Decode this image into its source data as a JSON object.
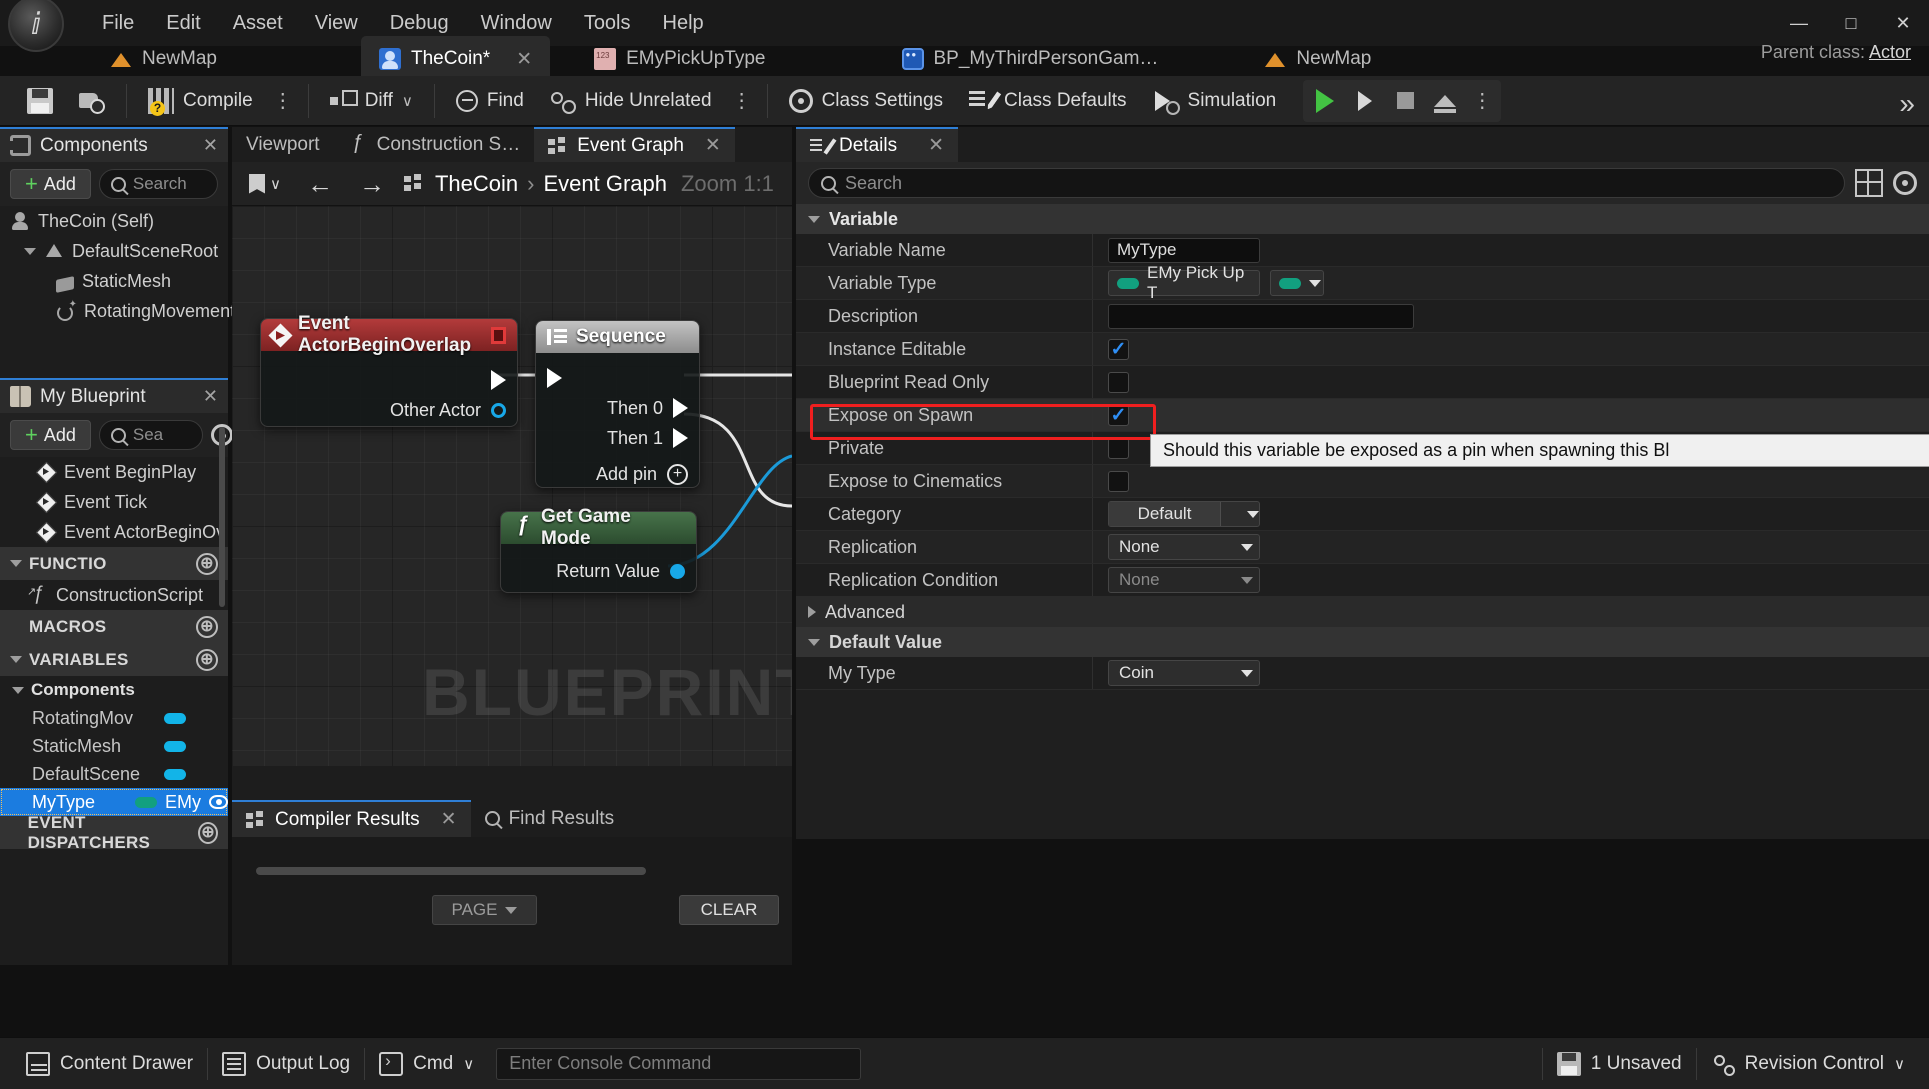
{
  "window": {
    "menu": [
      "File",
      "Edit",
      "Asset",
      "View",
      "Debug",
      "Window",
      "Tools",
      "Help"
    ],
    "minimize": "—",
    "maximize": "□",
    "close": "✕",
    "parent_class_label": "Parent class:",
    "parent_class_value": "Actor"
  },
  "tabs": [
    {
      "label": "NewMap",
      "icon": "map-icon",
      "active": false,
      "closable": false
    },
    {
      "label": "TheCoin*",
      "icon": "blueprint-actor-icon",
      "active": true,
      "closable": true,
      "close": "✕"
    },
    {
      "label": "EMyPickUpType",
      "icon": "enum-icon",
      "active": false,
      "closable": false
    },
    {
      "label": "BP_MyThirdPersonGam…",
      "icon": "gamemode-icon",
      "active": false,
      "closable": false
    },
    {
      "label": "NewMap",
      "icon": "map-icon",
      "active": false,
      "closable": false
    }
  ],
  "toolbar": {
    "save": "",
    "browse": "",
    "compile": "Compile",
    "compile_dots": "⋮",
    "diff": "Diff",
    "diff_chevron": "∨",
    "find": "Find",
    "hide_unrelated": "Hide Unrelated",
    "hide_dots": "⋮",
    "class_settings": "Class Settings",
    "class_defaults": "Class Defaults",
    "simulation": "Simulation",
    "play_dots": "⋮",
    "overflow": "»"
  },
  "components_panel": {
    "title": "Components",
    "close": "✕",
    "add_label": "Add",
    "search_placeholder": "Search",
    "tree": [
      {
        "label": "TheCoin (Self)",
        "icon": "actor-icon",
        "depth": 0,
        "expander": false
      },
      {
        "label": "DefaultSceneRoot",
        "icon": "scene-root-icon",
        "depth": 1,
        "expander": true
      },
      {
        "label": "StaticMesh",
        "icon": "static-mesh-icon",
        "depth": 2,
        "expander": false
      },
      {
        "label": "RotatingMovement",
        "icon": "rotating-movement-icon",
        "depth": 2,
        "expander": false
      }
    ]
  },
  "my_blueprint_panel": {
    "title": "My Blueprint",
    "close": "✕",
    "add_label": "Add",
    "search_placeholder": "Sea",
    "graphs": [
      {
        "label": "Event BeginPlay",
        "icon": "event-icon"
      },
      {
        "label": "Event Tick",
        "icon": "event-icon"
      },
      {
        "label": "Event ActorBeginOv",
        "icon": "event-icon"
      }
    ],
    "sections": {
      "functions": "FUNCTIO",
      "functions_item": "ConstructionScript",
      "macros": "MACROS",
      "variables": "VARIABLES",
      "components_group": "Components",
      "event_dispatchers": "EVENT DISPATCHERS"
    },
    "variables": [
      {
        "name": "RotatingMov",
        "type_color": "#12b4e8",
        "selected": false
      },
      {
        "name": "StaticMesh",
        "type_color": "#12b4e8",
        "selected": false
      },
      {
        "name": "DefaultScene",
        "type_color": "#12b4e8",
        "selected": false
      },
      {
        "name": "MyType",
        "type_short": "EMy",
        "type_color": "#12a07f",
        "selected": true
      }
    ],
    "add_icon": "⊕"
  },
  "graph": {
    "doc_tabs": [
      {
        "label": "Viewport",
        "active": false
      },
      {
        "label": "Construction S…",
        "active": false,
        "icon": "function-icon"
      },
      {
        "label": "Event Graph",
        "active": true,
        "icon": "grid-icon",
        "close": "✕"
      }
    ],
    "toolbar": {
      "bookmark_chevron": "∨",
      "back": "←",
      "forward": "→"
    },
    "breadcrumb_root": "TheCoin",
    "breadcrumb_sep": "›",
    "breadcrumb_leaf": "Event Graph",
    "zoom_label": "Zoom 1:1",
    "watermark": "BLUEPRINT",
    "nodes": [
      {
        "title": "Event ActorBeginOverlap",
        "icon": "event-node-icon",
        "header_style": "red",
        "pins_right": [
          "",
          "Other Actor"
        ]
      },
      {
        "title": "Sequence",
        "icon": "sequence-node-icon",
        "header_style": "gray",
        "pins_right": [
          "Then 0",
          "Then 1"
        ],
        "add_pin": "Add pin"
      },
      {
        "title": "Get Game Mode",
        "icon": "function-node-icon",
        "header_style": "green",
        "pins_right": [
          "Return Value"
        ]
      }
    ]
  },
  "compiler_results": {
    "tabs": [
      {
        "label": "Compiler Results",
        "active": true,
        "icon": "compiler-icon",
        "close": "✕"
      },
      {
        "label": "Find Results",
        "active": false,
        "icon": "search-icon"
      }
    ],
    "page_label": "PAGE",
    "clear_label": "CLEAR"
  },
  "details": {
    "tab_label": "Details",
    "tab_close": "✕",
    "search_placeholder": "Search",
    "category_variable": "Variable",
    "rows": [
      {
        "label": "Variable Name",
        "type": "text",
        "value": "MyType"
      },
      {
        "label": "Variable Type",
        "type": "enumtype",
        "value": "EMy Pick Up T",
        "color": "#12a07f"
      },
      {
        "label": "Description",
        "type": "text-wide",
        "value": ""
      },
      {
        "label": "Instance Editable",
        "type": "checkbox",
        "checked": true
      },
      {
        "label": "Blueprint Read Only",
        "type": "checkbox",
        "checked": false
      },
      {
        "label": "Expose on Spawn",
        "type": "checkbox",
        "checked": true,
        "highlighted": true
      },
      {
        "label": "Private",
        "type": "checkbox",
        "checked": false
      },
      {
        "label": "Expose to Cinematics",
        "type": "checkbox",
        "checked": false
      },
      {
        "label": "Category",
        "type": "combo-split",
        "value": "Default"
      },
      {
        "label": "Replication",
        "type": "combo",
        "value": "None"
      },
      {
        "label": "Replication Condition",
        "type": "combo-dim",
        "value": "None"
      }
    ],
    "advanced_label": "Advanced",
    "default_value_label": "Default Value",
    "default_rows": [
      {
        "label": "My Type",
        "type": "combo",
        "value": "Coin"
      }
    ],
    "tooltip": "Should this variable be exposed as a pin when spawning this Bl"
  },
  "statusbar": {
    "content_drawer": "Content Drawer",
    "output_log": "Output Log",
    "cmd": "Cmd",
    "cmd_chevron": "∨",
    "console_placeholder": "Enter Console Command",
    "unsaved": "1 Unsaved",
    "revision_control": "Revision Control",
    "revision_chevron": "∨"
  },
  "colors": {
    "accent_blue": "#2f7fd6",
    "selection_blue": "#1b7ce0",
    "highlight_red": "#f01f1f",
    "green_plus": "#5fd15f",
    "enum_teal": "#12a07f",
    "object_blue": "#12b4e8"
  }
}
